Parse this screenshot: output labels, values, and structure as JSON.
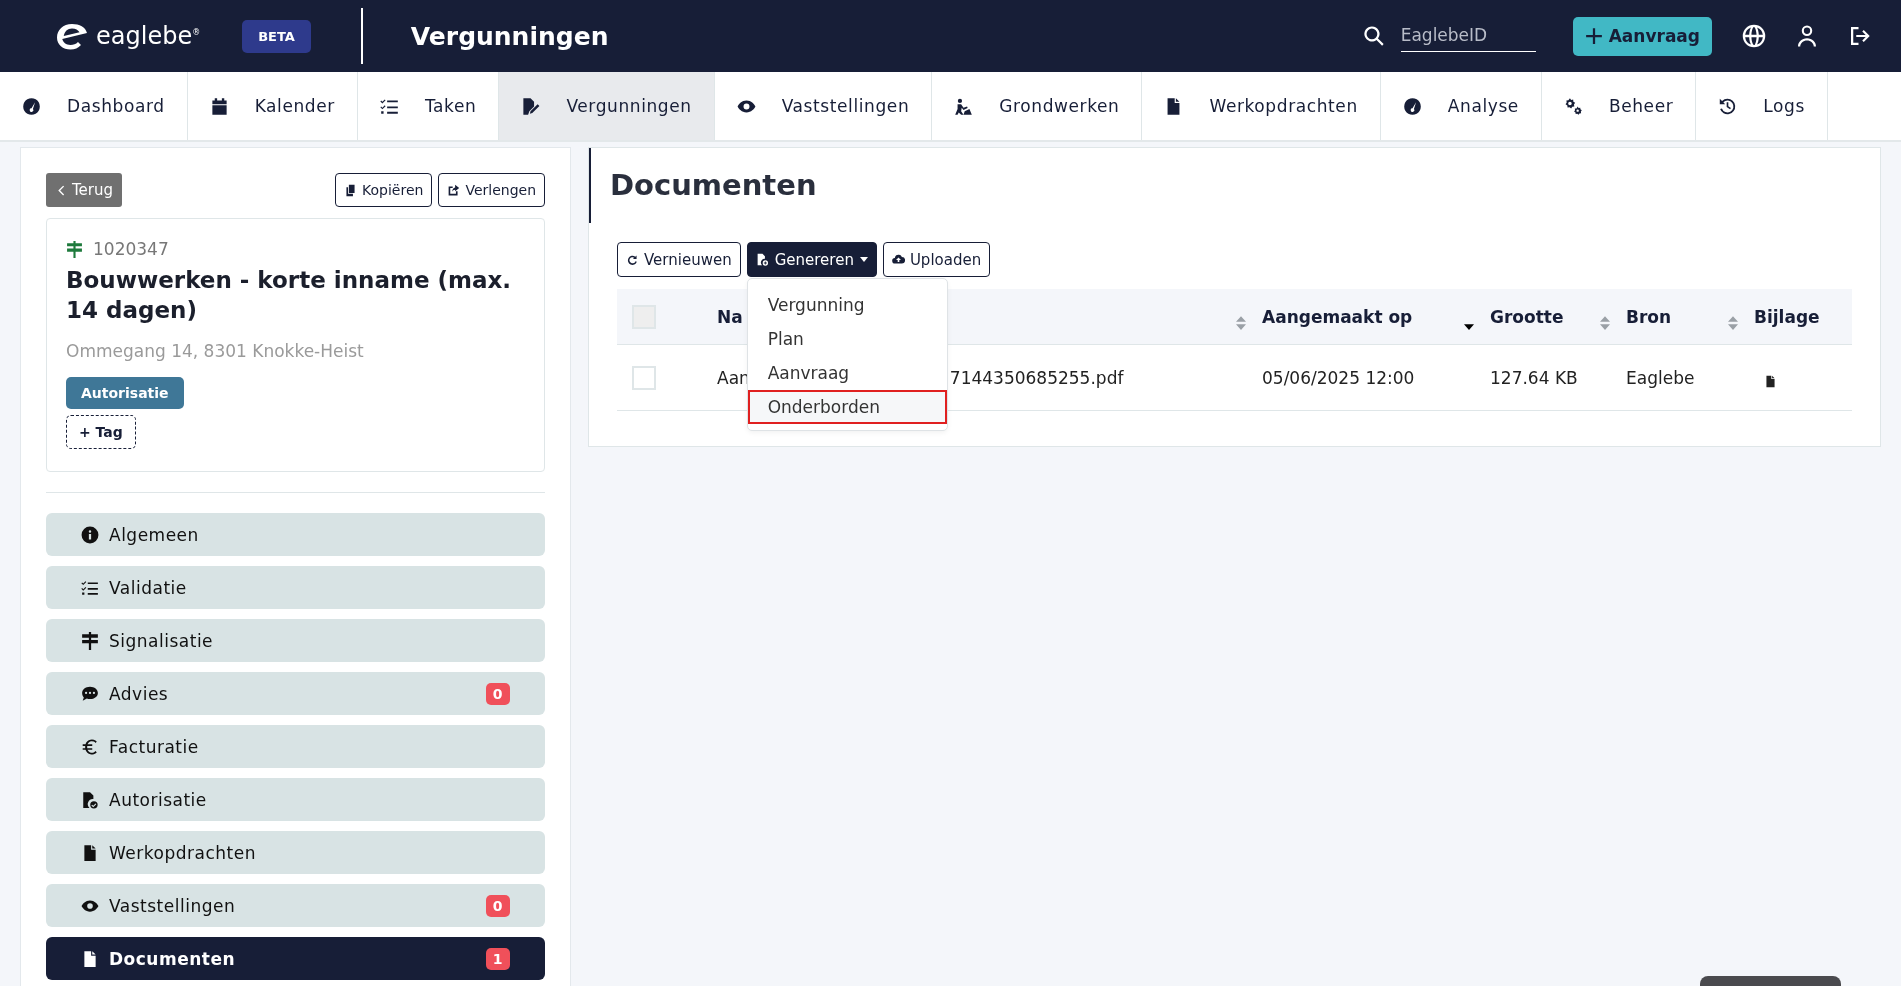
{
  "header": {
    "logo": {
      "name": "eaglebe",
      "mark": "®"
    },
    "badge": "BETA",
    "title": "Vergunningen",
    "search": {
      "placeholder": "EaglebeID"
    },
    "new_button": "Aanvraag"
  },
  "nav_tabs": [
    {
      "label": "Dashboard",
      "selected": false
    },
    {
      "label": "Kalender",
      "selected": false
    },
    {
      "label": "Taken",
      "selected": false
    },
    {
      "label": "Vergunningen",
      "selected": true
    },
    {
      "label": "Vaststellingen",
      "selected": false
    },
    {
      "label": "Grondwerken",
      "selected": false
    },
    {
      "label": "Werkopdrachten",
      "selected": false
    },
    {
      "label": "Analyse",
      "selected": false
    },
    {
      "label": "Beheer",
      "selected": false
    },
    {
      "label": "Logs",
      "selected": false
    }
  ],
  "sidebar": {
    "back_button": "Terug",
    "actions": [
      "Kopiëren",
      "Verlengen"
    ],
    "permit": {
      "number": "1020347",
      "title": "Bouwwerken - korte inname (max. 14 dagen)",
      "address": "Ommegang 14, 8301 Knokke-Heist",
      "tags": [
        "Autorisatie"
      ],
      "add_tag": "+ Tag"
    },
    "items": [
      {
        "label": "Algemeen",
        "selected": false
      },
      {
        "label": "Validatie",
        "selected": false
      },
      {
        "label": "Signalisatie",
        "selected": false
      },
      {
        "label": "Advies",
        "selected": false,
        "count": "0"
      },
      {
        "label": "Facturatie",
        "selected": false
      },
      {
        "label": "Autorisatie",
        "selected": false
      },
      {
        "label": "Werkopdrachten",
        "selected": false
      },
      {
        "label": "Vaststellingen",
        "selected": false,
        "count": "0"
      },
      {
        "label": "Documenten",
        "selected": true,
        "count": "1"
      }
    ]
  },
  "main": {
    "title": "Documenten",
    "buttons": [
      {
        "label": "Vernieuwen",
        "kind": "outline"
      },
      {
        "label": "Genereren",
        "kind": "dropdown",
        "expanded": true
      },
      {
        "label": "Uploaden",
        "kind": "outline"
      }
    ],
    "dropdown_items": [
      {
        "label": "Vergunning",
        "selected": false
      },
      {
        "label": "Plan",
        "selected": false
      },
      {
        "label": "Aanvraag",
        "selected": false
      },
      {
        "label": "Onderborden",
        "selected": true
      }
    ],
    "table": {
      "select_all_checked": false,
      "columns": [
        {
          "label": "Na",
          "sortable": true,
          "sorted_descending": false
        },
        {
          "label": "Aangemaakt op",
          "sortable": true,
          "sorted_descending": true
        },
        {
          "label": "Grootte",
          "sortable": true,
          "sorted_descending": false
        },
        {
          "label": "Bron",
          "sortable": true,
          "sorted_descending": false
        },
        {
          "label": "Bijlage"
        }
      ],
      "rows": [
        {
          "checked": false,
          "name_start": "Aan",
          "name_end": "7144350685255.pdf",
          "created": "05/06/2025 12:00",
          "size": "127.64 KB",
          "source": "Eaglebe",
          "attachment": true
        }
      ]
    }
  }
}
